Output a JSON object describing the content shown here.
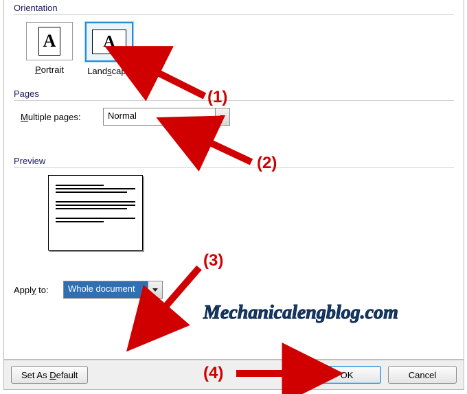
{
  "orientation": {
    "header": "Orientation",
    "portrait_label": "Portrait",
    "landscape_label": "Landscape",
    "glyph": "A"
  },
  "pages": {
    "header": "Pages",
    "multiple_label": "Multiple pages:",
    "multiple_value": "Normal"
  },
  "preview": {
    "header": "Preview"
  },
  "apply": {
    "label": "Apply to:",
    "value": "Whole document"
  },
  "buttons": {
    "default": "Set As Default",
    "ok": "OK",
    "cancel": "Cancel"
  },
  "annotations": {
    "a1": "(1)",
    "a2": "(2)",
    "a3": "(3)",
    "a4": "(4)",
    "watermark": "Mechanicalengblog.com"
  }
}
